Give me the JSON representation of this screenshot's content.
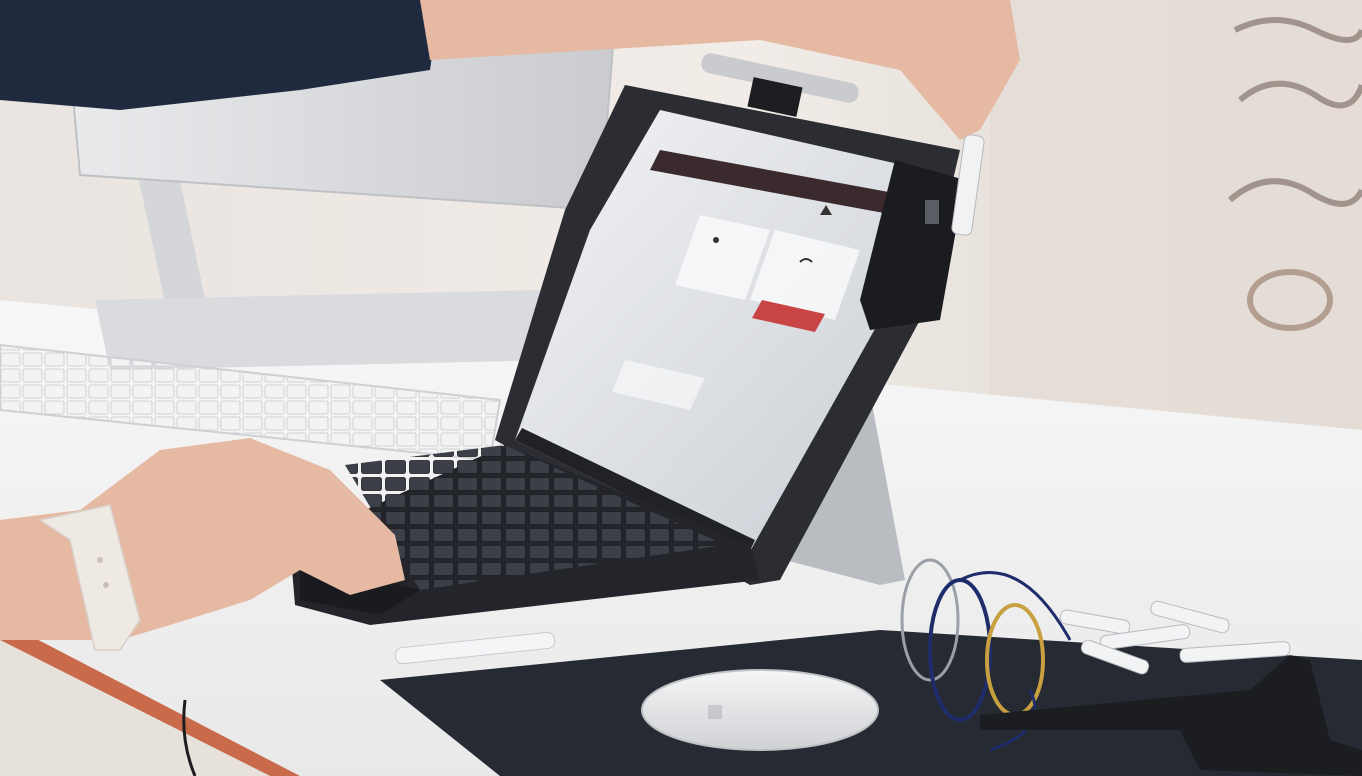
{
  "scene": {
    "kind": "photo",
    "palette": {
      "wall": "#ece7e2",
      "wall_right": "#dcd6d0",
      "desk": "#f4f4f4",
      "desk_edge": "#c96a4b",
      "laptop_body": "#2b2d33",
      "screen_bg": "#e9ebee",
      "screen_header": "#3a2a2e",
      "screen_button": "#c94545",
      "keyboard_white": "#e6e7e9",
      "skin": "#e6b9a2",
      "mat": "#262a33",
      "mouse": "#e9eaec",
      "watch_band": "#efe9e4",
      "sleeve": "#1f2a3f"
    },
    "icons": [
      "info-icon",
      "signal-icon",
      "hand-icon",
      "usb-port-icon"
    ]
  }
}
